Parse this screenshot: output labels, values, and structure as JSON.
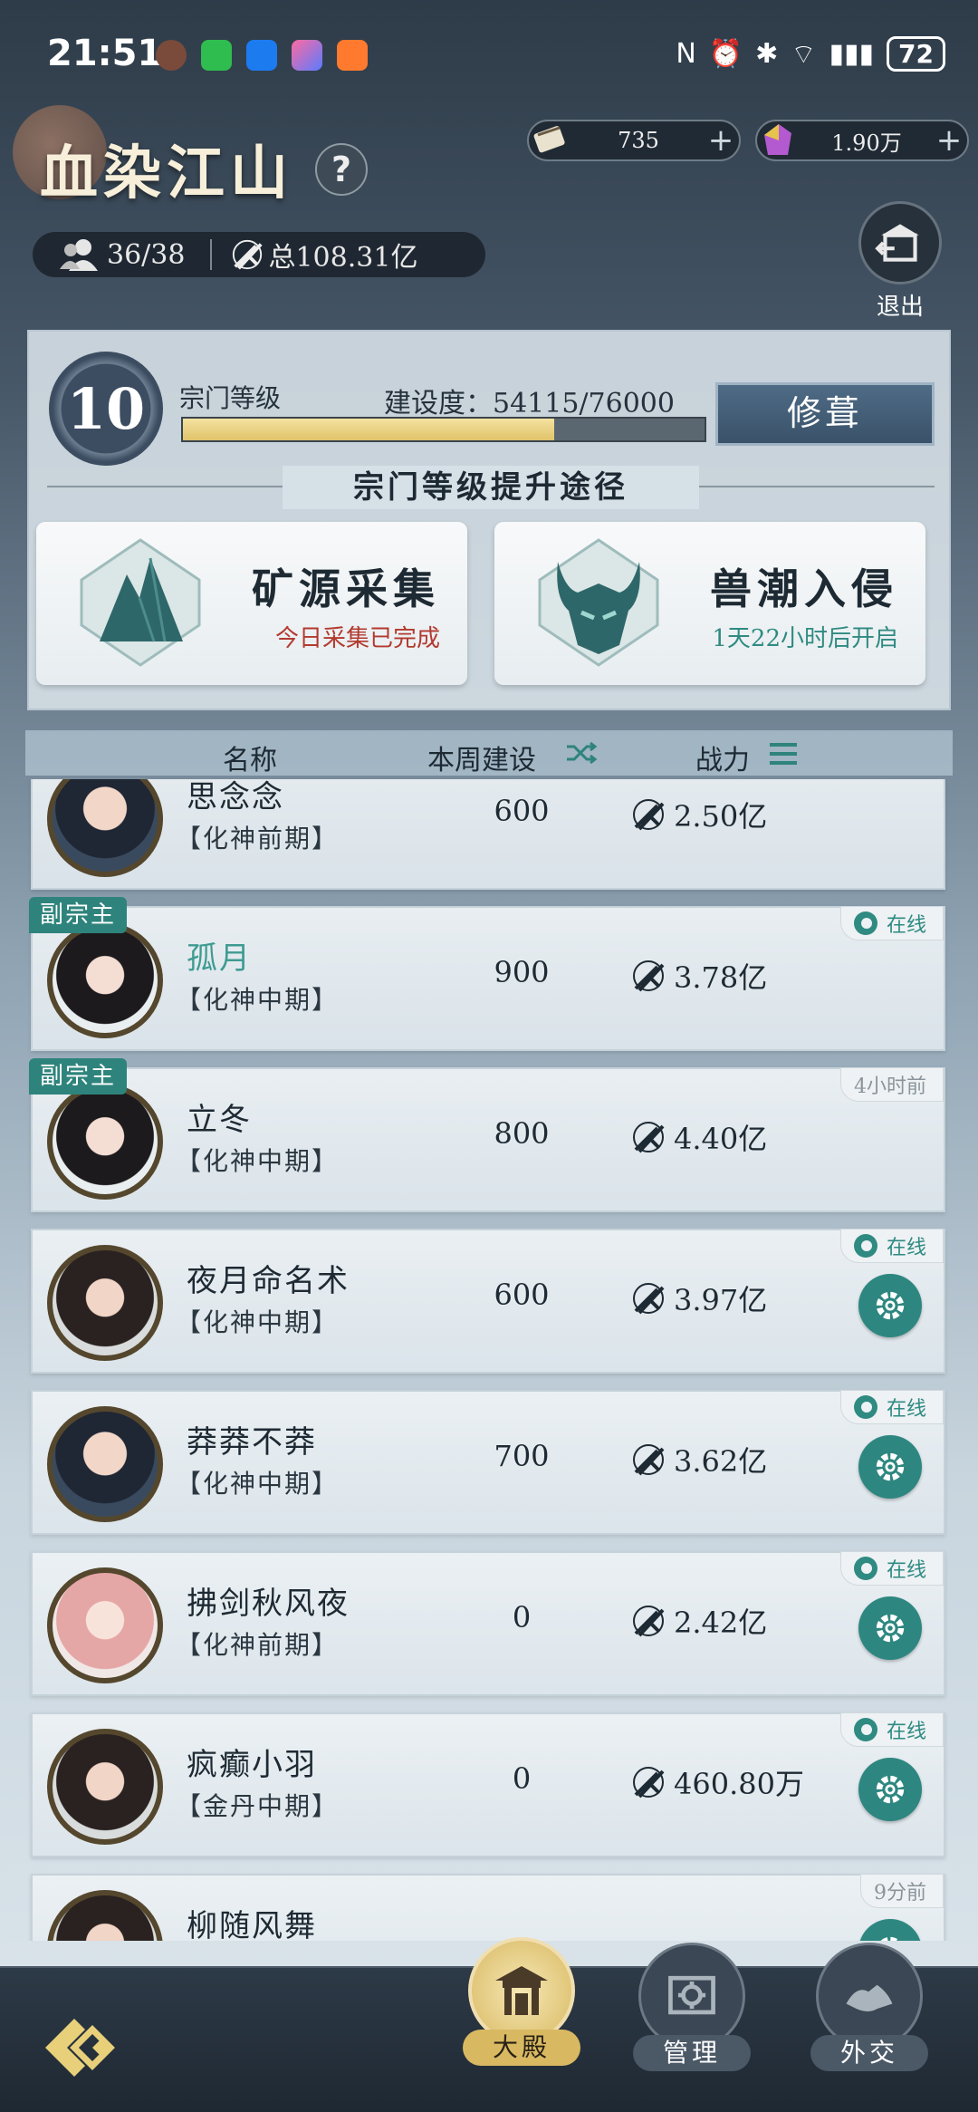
{
  "status_bar": {
    "time": "21:51",
    "battery": "72"
  },
  "header": {
    "sect_name": "血染江山",
    "help_label": "?",
    "resources": [
      {
        "value": "735",
        "plus": "+"
      },
      {
        "value": "1.90万",
        "plus": "+"
      }
    ],
    "members": "36/38",
    "total_power": "总108.31亿",
    "exit_label": "退出"
  },
  "sect": {
    "level": "10",
    "level_label": "宗门等级",
    "build_label": "建设度：54115/76000",
    "build_progress": 0.712,
    "repair_label": "修葺",
    "path_title": "宗门等级提升途径",
    "paths": [
      {
        "name": "矿源采集",
        "status": "今日采集已完成",
        "status_color": "#b33a2f"
      },
      {
        "name": "兽潮入侵",
        "status": "1天22小时后开启",
        "status_color": "#2f8a82"
      }
    ]
  },
  "list": {
    "col_name": "名称",
    "col_contrib": "本周建设",
    "col_power": "战力",
    "members": [
      {
        "name": "思念念",
        "realm": "【化神前期】",
        "contrib": "600",
        "power": "2.50亿",
        "status": "",
        "online": false,
        "role": "",
        "gear": false,
        "highlight": false
      },
      {
        "name": "孤月",
        "realm": "【化神中期】",
        "contrib": "900",
        "power": "3.78亿",
        "status": "在线",
        "online": true,
        "role": "副宗主",
        "gear": false,
        "highlight": true
      },
      {
        "name": "立冬",
        "realm": "【化神中期】",
        "contrib": "800",
        "power": "4.40亿",
        "status": "4小时前",
        "online": false,
        "role": "副宗主",
        "gear": false,
        "highlight": false
      },
      {
        "name": "夜月命名术",
        "realm": "【化神中期】",
        "contrib": "600",
        "power": "3.97亿",
        "status": "在线",
        "online": true,
        "role": "",
        "gear": true,
        "highlight": false
      },
      {
        "name": "莽莽不莽",
        "realm": "【化神中期】",
        "contrib": "700",
        "power": "3.62亿",
        "status": "在线",
        "online": true,
        "role": "",
        "gear": true,
        "highlight": false
      },
      {
        "name": "拂剑秋风夜",
        "realm": "【化神前期】",
        "contrib": "0",
        "power": "2.42亿",
        "status": "在线",
        "online": true,
        "role": "",
        "gear": true,
        "highlight": false
      },
      {
        "name": "疯癫小羽",
        "realm": "【金丹中期】",
        "contrib": "0",
        "power": "460.80万",
        "status": "在线",
        "online": true,
        "role": "",
        "gear": true,
        "highlight": false
      },
      {
        "name": "柳随风舞",
        "realm": "",
        "contrib": "",
        "power": "",
        "status": "9分前",
        "online": false,
        "role": "",
        "gear": true,
        "highlight": false
      }
    ]
  },
  "nav": {
    "hall": "大殿",
    "manage": "管理",
    "diplomacy": "外交"
  }
}
